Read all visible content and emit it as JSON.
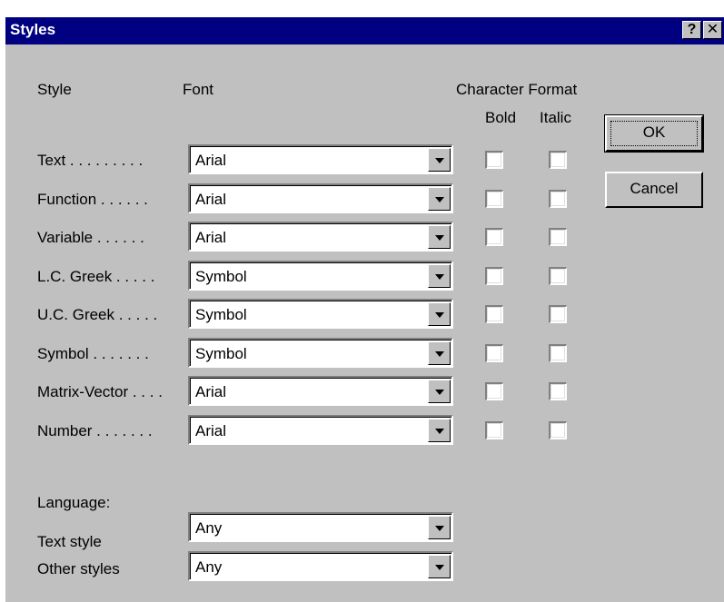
{
  "window": {
    "title": "Styles",
    "help_label": "?",
    "close_label": "✕"
  },
  "headers": {
    "style": "Style",
    "font": "Font",
    "character_format": "Character Format",
    "bold": "Bold",
    "italic": "Italic"
  },
  "styles": [
    {
      "label": "Text . . . . . . . . .",
      "font": "Arial",
      "bold": false,
      "italic": false
    },
    {
      "label": "Function . . . . . .",
      "font": "Arial",
      "bold": false,
      "italic": false
    },
    {
      "label": "Variable . . . . . .",
      "font": "Arial",
      "bold": false,
      "italic": false
    },
    {
      "label": "L.C. Greek . . . . .",
      "font": "Symbol",
      "bold": false,
      "italic": false
    },
    {
      "label": "U.C. Greek . . . . .",
      "font": "Symbol",
      "bold": false,
      "italic": false
    },
    {
      "label": "Symbol . . . . . . .",
      "font": "Symbol",
      "bold": false,
      "italic": false
    },
    {
      "label": "Matrix-Vector . . . .",
      "font": "Arial",
      "bold": false,
      "italic": false
    },
    {
      "label": "Number . . . . . . .",
      "font": "Arial",
      "bold": false,
      "italic": false
    }
  ],
  "language": {
    "heading": "Language:",
    "text_style": {
      "label": "Text style",
      "value": "Any"
    },
    "other_styles": {
      "label": "Other styles",
      "value": "Any"
    }
  },
  "buttons": {
    "ok": "OK",
    "cancel": "Cancel"
  },
  "colors": {
    "titlebar": "#000080",
    "face": "#c0c0c0"
  }
}
